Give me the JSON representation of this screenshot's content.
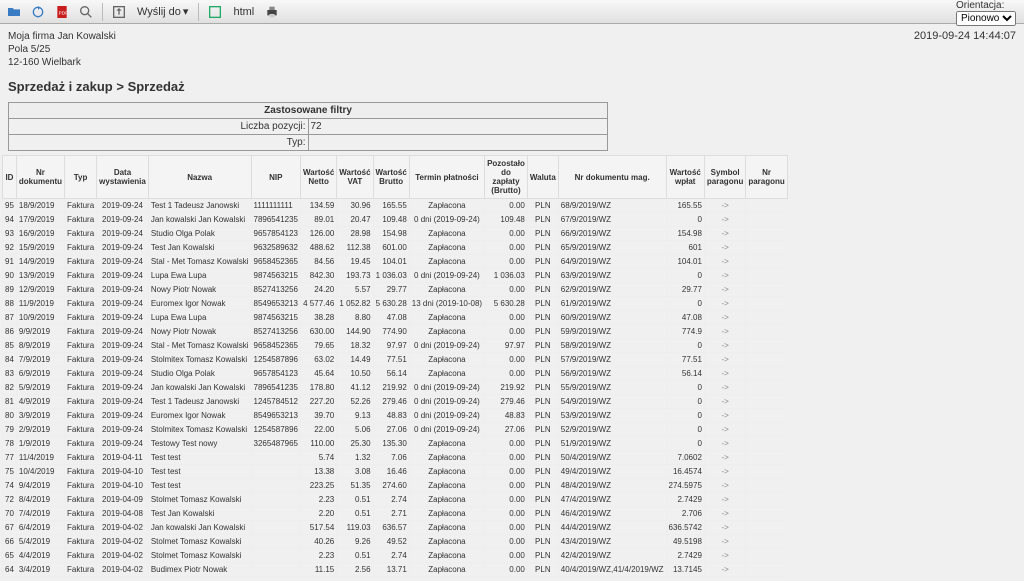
{
  "timestamp": "2019-09-24 14:44:07",
  "orient_label": "Orientacja:",
  "orient_value": "Pionowo",
  "toolbar": {
    "wyslij": "Wyślij do",
    "html": "html"
  },
  "company": {
    "l1": "Moja firma Jan Kowalski",
    "l2": "Pola 5/25",
    "l3": "12-160 Wielbark"
  },
  "breadcrumb": "Sprzedaż i zakup > Sprzedaż",
  "filters": {
    "title": "Zastosowane filtry",
    "count_label": "Liczba pozycji:",
    "count_value": "72",
    "typ_label": "Typ:",
    "typ_value": ""
  },
  "cols": [
    "ID",
    "Nr dokumentu",
    "Typ",
    "Data wystawienia",
    "Nazwa",
    "NIP",
    "Wartość Netto",
    "Wartość VAT",
    "Wartość Brutto",
    "Termin płatności",
    "Pozostało do zapłaty (Brutto)",
    "Waluta",
    "Nr dokumentu mag.",
    "Wartość wpłat",
    "Symbol paragonu",
    "Nr paragonu"
  ],
  "rows": [
    [
      "95",
      "18/9/2019",
      "Faktura",
      "2019-09-24",
      "Test 1 Tadeusz Janowski",
      "1111111111",
      "134.59",
      "30.96",
      "165.55",
      "Zapłacona",
      "0.00",
      "PLN",
      "68/9/2019/WZ",
      "165.55",
      "->",
      ""
    ],
    [
      "94",
      "17/9/2019",
      "Faktura",
      "2019-09-24",
      "Jan kowalski Jan Kowalski",
      "7896541235",
      "89.01",
      "20.47",
      "109.48",
      "0 dni (2019-09-24)",
      "109.48",
      "PLN",
      "67/9/2019/WZ",
      "0",
      "->",
      ""
    ],
    [
      "93",
      "16/9/2019",
      "Faktura",
      "2019-09-24",
      "Studio Olga Polak",
      "9657854123",
      "126.00",
      "28.98",
      "154.98",
      "Zapłacona",
      "0.00",
      "PLN",
      "66/9/2019/WZ",
      "154.98",
      "->",
      ""
    ],
    [
      "92",
      "15/9/2019",
      "Faktura",
      "2019-09-24",
      "Test Jan Kowalski",
      "9632589632",
      "488.62",
      "112.38",
      "601.00",
      "Zapłacona",
      "0.00",
      "PLN",
      "65/9/2019/WZ",
      "601",
      "->",
      ""
    ],
    [
      "91",
      "14/9/2019",
      "Faktura",
      "2019-09-24",
      "Stal - Met Tomasz Kowalski",
      "9658452365",
      "84.56",
      "19.45",
      "104.01",
      "Zapłacona",
      "0.00",
      "PLN",
      "64/9/2019/WZ",
      "104.01",
      "->",
      ""
    ],
    [
      "90",
      "13/9/2019",
      "Faktura",
      "2019-09-24",
      "Lupa Ewa Lupa",
      "9874563215",
      "842.30",
      "193.73",
      "1 036.03",
      "0 dni (2019-09-24)",
      "1 036.03",
      "PLN",
      "63/9/2019/WZ",
      "0",
      "->",
      ""
    ],
    [
      "89",
      "12/9/2019",
      "Faktura",
      "2019-09-24",
      "Nowy Piotr Nowak",
      "8527413256",
      "24.20",
      "5.57",
      "29.77",
      "Zapłacona",
      "0.00",
      "PLN",
      "62/9/2019/WZ",
      "29.77",
      "->",
      ""
    ],
    [
      "88",
      "11/9/2019",
      "Faktura",
      "2019-09-24",
      "Euromex Igor Nowak",
      "8549653213",
      "4 577.46",
      "1 052.82",
      "5 630.28",
      "13 dni (2019-10-08)",
      "5 630.28",
      "PLN",
      "61/9/2019/WZ",
      "0",
      "->",
      ""
    ],
    [
      "87",
      "10/9/2019",
      "Faktura",
      "2019-09-24",
      "Lupa Ewa Lupa",
      "9874563215",
      "38.28",
      "8.80",
      "47.08",
      "Zapłacona",
      "0.00",
      "PLN",
      "60/9/2019/WZ",
      "47.08",
      "->",
      ""
    ],
    [
      "86",
      "9/9/2019",
      "Faktura",
      "2019-09-24",
      "Nowy Piotr Nowak",
      "8527413256",
      "630.00",
      "144.90",
      "774.90",
      "Zapłacona",
      "0.00",
      "PLN",
      "59/9/2019/WZ",
      "774.9",
      "->",
      ""
    ],
    [
      "85",
      "8/9/2019",
      "Faktura",
      "2019-09-24",
      "Stal - Met Tomasz Kowalski",
      "9658452365",
      "79.65",
      "18.32",
      "97.97",
      "0 dni (2019-09-24)",
      "97.97",
      "PLN",
      "58/9/2019/WZ",
      "0",
      "->",
      ""
    ],
    [
      "84",
      "7/9/2019",
      "Faktura",
      "2019-09-24",
      "Stolmitex Tomasz Kowalski",
      "1254587896",
      "63.02",
      "14.49",
      "77.51",
      "Zapłacona",
      "0.00",
      "PLN",
      "57/9/2019/WZ",
      "77.51",
      "->",
      ""
    ],
    [
      "83",
      "6/9/2019",
      "Faktura",
      "2019-09-24",
      "Studio Olga Polak",
      "9657854123",
      "45.64",
      "10.50",
      "56.14",
      "Zapłacona",
      "0.00",
      "PLN",
      "56/9/2019/WZ",
      "56.14",
      "->",
      ""
    ],
    [
      "82",
      "5/9/2019",
      "Faktura",
      "2019-09-24",
      "Jan kowalski Jan Kowalski",
      "7896541235",
      "178.80",
      "41.12",
      "219.92",
      "0 dni (2019-09-24)",
      "219.92",
      "PLN",
      "55/9/2019/WZ",
      "0",
      "->",
      ""
    ],
    [
      "81",
      "4/9/2019",
      "Faktura",
      "2019-09-24",
      "Test 1 Tadeusz Janowski",
      "1245784512",
      "227.20",
      "52.26",
      "279.46",
      "0 dni (2019-09-24)",
      "279.46",
      "PLN",
      "54/9/2019/WZ",
      "0",
      "->",
      ""
    ],
    [
      "80",
      "3/9/2019",
      "Faktura",
      "2019-09-24",
      "Euromex Igor Nowak",
      "8549653213",
      "39.70",
      "9.13",
      "48.83",
      "0 dni (2019-09-24)",
      "48.83",
      "PLN",
      "53/9/2019/WZ",
      "0",
      "->",
      ""
    ],
    [
      "79",
      "2/9/2019",
      "Faktura",
      "2019-09-24",
      "Stolmitex Tomasz Kowalski",
      "1254587896",
      "22.00",
      "5.06",
      "27.06",
      "0 dni (2019-09-24)",
      "27.06",
      "PLN",
      "52/9/2019/WZ",
      "0",
      "->",
      ""
    ],
    [
      "78",
      "1/9/2019",
      "Faktura",
      "2019-09-24",
      "Testowy Test nowy",
      "3265487965",
      "110.00",
      "25.30",
      "135.30",
      "Zapłacona",
      "0.00",
      "PLN",
      "51/9/2019/WZ",
      "0",
      "->",
      ""
    ],
    [
      "77",
      "11/4/2019",
      "Faktura",
      "2019-04-11",
      "Test test",
      "",
      "5.74",
      "1.32",
      "7.06",
      "Zapłacona",
      "0.00",
      "PLN",
      "50/4/2019/WZ",
      "7.0602",
      "->",
      ""
    ],
    [
      "75",
      "10/4/2019",
      "Faktura",
      "2019-04-10",
      "Test test",
      "",
      "13.38",
      "3.08",
      "16.46",
      "Zapłacona",
      "0.00",
      "PLN",
      "49/4/2019/WZ",
      "16.4574",
      "->",
      ""
    ],
    [
      "74",
      "9/4/2019",
      "Faktura",
      "2019-04-10",
      "Test test",
      "",
      "223.25",
      "51.35",
      "274.60",
      "Zapłacona",
      "0.00",
      "PLN",
      "48/4/2019/WZ",
      "274.5975",
      "->",
      ""
    ],
    [
      "72",
      "8/4/2019",
      "Faktura",
      "2019-04-09",
      "Stolmet Tomasz Kowalski",
      "",
      "2.23",
      "0.51",
      "2.74",
      "Zapłacona",
      "0.00",
      "PLN",
      "47/4/2019/WZ",
      "2.7429",
      "->",
      ""
    ],
    [
      "70",
      "7/4/2019",
      "Faktura",
      "2019-04-08",
      "Test Jan Kowalski",
      "",
      "2.20",
      "0.51",
      "2.71",
      "Zapłacona",
      "0.00",
      "PLN",
      "46/4/2019/WZ",
      "2.706",
      "->",
      ""
    ],
    [
      "67",
      "6/4/2019",
      "Faktura",
      "2019-04-02",
      "Jan kowalski Jan Kowalski",
      "",
      "517.54",
      "119.03",
      "636.57",
      "Zapłacona",
      "0.00",
      "PLN",
      "44/4/2019/WZ",
      "636.5742",
      "->",
      ""
    ],
    [
      "66",
      "5/4/2019",
      "Faktura",
      "2019-04-02",
      "Stolmet Tomasz Kowalski",
      "",
      "40.26",
      "9.26",
      "49.52",
      "Zapłacona",
      "0.00",
      "PLN",
      "43/4/2019/WZ",
      "49.5198",
      "->",
      ""
    ],
    [
      "65",
      "4/4/2019",
      "Faktura",
      "2019-04-02",
      "Stolmet Tomasz Kowalski",
      "",
      "2.23",
      "0.51",
      "2.74",
      "Zapłacona",
      "0.00",
      "PLN",
      "42/4/2019/WZ",
      "2.7429",
      "->",
      ""
    ],
    [
      "64",
      "3/4/2019",
      "Faktura",
      "2019-04-02",
      "Budimex Piotr Nowak",
      "",
      "11.15",
      "2.56",
      "13.71",
      "Zapłacona",
      "0.00",
      "PLN",
      "40/4/2019/WZ,41/4/2019/WZ",
      "13.7145",
      "->",
      ""
    ]
  ]
}
